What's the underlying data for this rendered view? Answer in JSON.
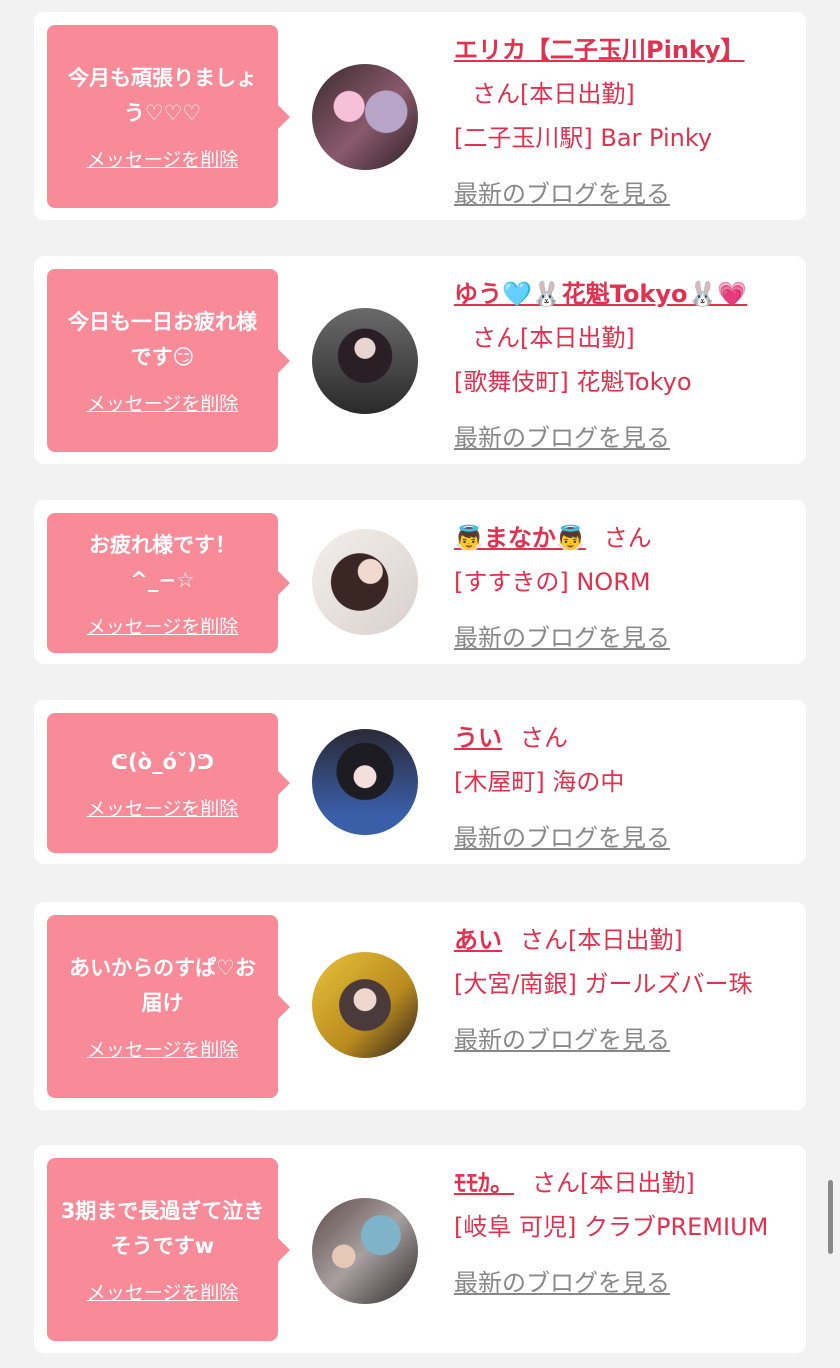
{
  "ui": {
    "delete_label": "メッセージを削除",
    "blog_label": "最新のブログを見る",
    "suffix": "さん"
  },
  "colors": {
    "bubble": "#f98a98",
    "accent": "#e2314f",
    "link_gray": "#888888",
    "background": "#f2f2f2"
  },
  "messages": [
    {
      "message": "今月も頑張りましょう♡♡♡",
      "name": "エリカ【二子玉川Pinky】",
      "status": "[本日出勤]",
      "shop": "[二子玉川駅] Bar Pinky"
    },
    {
      "message": "今日も一日お疲れ様です😏",
      "name": "ゆう🩵🐰花魁Tokyo🐰💗",
      "status": "[本日出勤]",
      "shop": "[歌舞伎町] 花魁Tokyo"
    },
    {
      "message": "お疲れ様です！ ^_−☆",
      "name": "👼まなか👼",
      "status": "",
      "shop": "[すすきの] NORM"
    },
    {
      "message": "ᕦ(ò_óˇ)ᕤ",
      "name": "うい",
      "status": "",
      "shop": "[木屋町] 海の中"
    },
    {
      "message": "あいからのすぱ♡お届け",
      "name": "あい",
      "status": "[本日出勤]",
      "shop": "[大宮/南銀] ガールズバー珠"
    },
    {
      "message": "3期まで長過ぎて泣きそうですw",
      "name": "ﾓﾓｶ。",
      "status": "[本日出勤]",
      "shop": "[岐阜 可児] クラブPREMIUM"
    }
  ]
}
